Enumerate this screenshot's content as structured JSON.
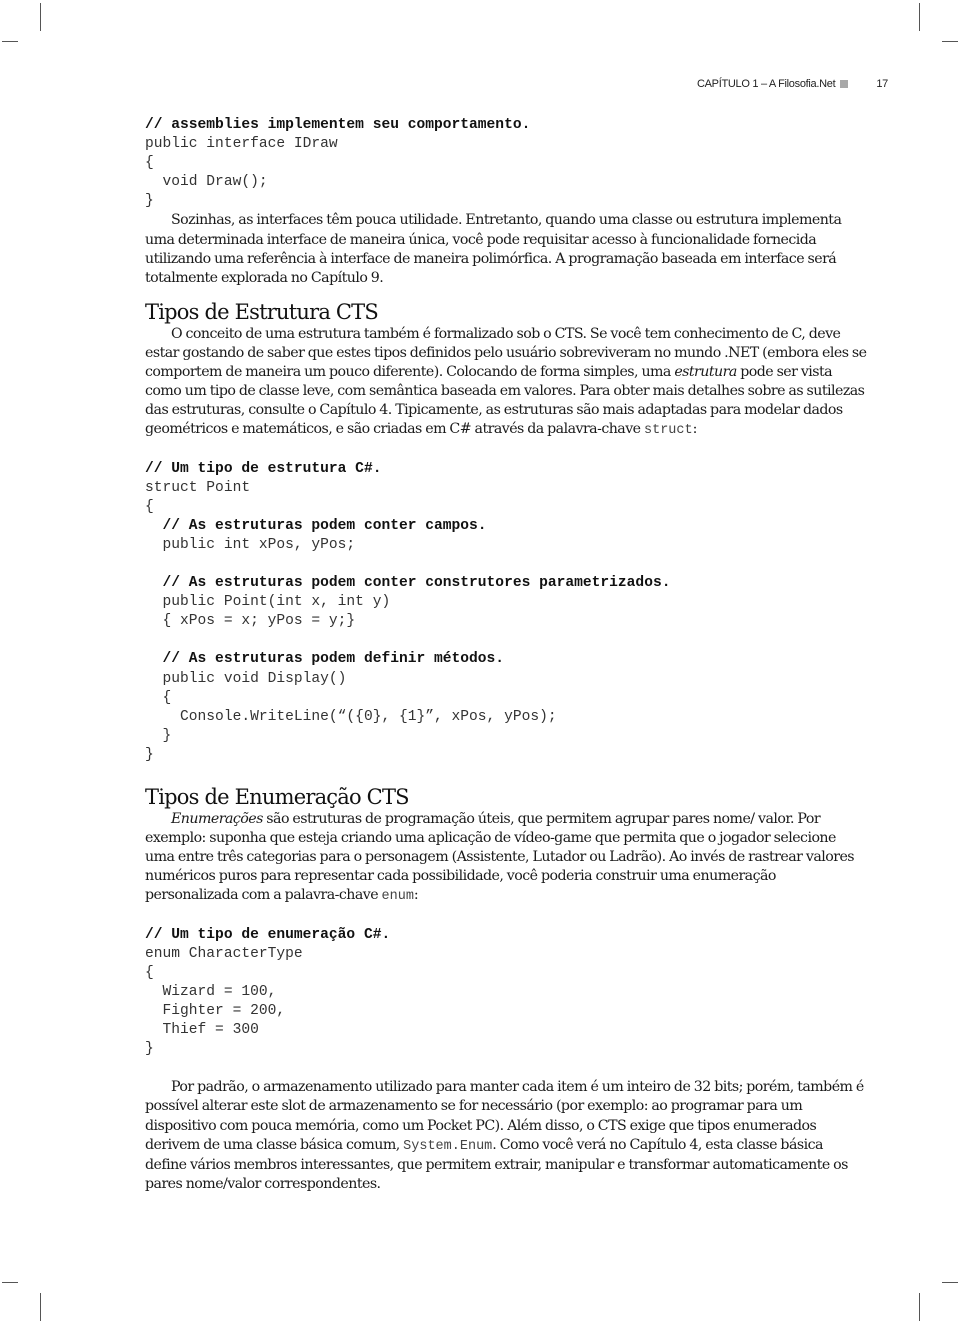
{
  "page_header": {
    "chapter": "CAPÍTULO 1 – A Filosofia.Net",
    "page_number": "17"
  },
  "code_block_1": {
    "lines": [
      {
        "text": "// assemblies implementem seu comportamento.",
        "type": "comment"
      },
      {
        "text": "public interface IDraw",
        "type": "code"
      },
      {
        "text": "{",
        "type": "code"
      },
      {
        "text": "  void Draw();",
        "type": "code"
      },
      {
        "text": "}",
        "type": "code"
      }
    ]
  },
  "para_1": {
    "text": "Sozinhas, as interfaces têm pouca utilidade. Entretanto, quando uma classe ou estrutura implementa uma determinada interface de maneira única, você pode requisitar acesso à funcionalidade fornecida utilizando uma referência à interface de maneira polimórfica. A programação baseada em interface será totalmente explorada no Capítulo 9."
  },
  "section_struct": {
    "heading": "Tipos de Estrutura CTS",
    "para_a": "O conceito de uma estrutura também é formalizado sob o CTS. Se você tem conhecimento de C, deve estar gostando de saber que estes tipos definidos pelo usuário sobreviveram no mundo .NET (embora eles se comportem de maneira um pouco diferente). Colocando de forma simples, uma ",
    "para_italic": "estrutura",
    "para_b": " pode ser vista como um tipo de classe leve, com semântica baseada em valores. Para obter mais detalhes sobre as sutilezas das estruturas, consulte o Capítulo 4. Tipicamente, as estruturas são mais adaptadas para modelar dados geométricos e matemáticos, e são criadas em C# através da palavra-chave ",
    "para_code": "struct",
    "para_end": ":"
  },
  "code_block_2": {
    "lines": [
      {
        "text": "// Um tipo de estrutura C#.",
        "type": "comment"
      },
      {
        "text": "struct Point",
        "type": "code"
      },
      {
        "text": "{",
        "type": "code"
      },
      {
        "text": "  // As estruturas podem conter campos.",
        "type": "comment"
      },
      {
        "text": "  public int xPos, yPos;",
        "type": "code"
      },
      {
        "text": "",
        "type": "code"
      },
      {
        "text": "  // As estruturas podem conter construtores parametrizados.",
        "type": "comment"
      },
      {
        "text": "  public Point(int x, int y)",
        "type": "code"
      },
      {
        "text": "  { xPos = x; yPos = y;}",
        "type": "code"
      },
      {
        "text": "",
        "type": "code"
      },
      {
        "text": "  // As estruturas podem definir métodos.",
        "type": "comment"
      },
      {
        "text": "  public void Display()",
        "type": "code"
      },
      {
        "text": "  {",
        "type": "code"
      },
      {
        "text": "    Console.WriteLine(“({0}, {1}”, xPos, yPos);",
        "type": "code"
      },
      {
        "text": "  }",
        "type": "code"
      },
      {
        "text": "}",
        "type": "code"
      }
    ]
  },
  "section_enum": {
    "heading": "Tipos de Enumeração CTS",
    "para_italic": "Enumerações",
    "para_a": " são estruturas de programação úteis, que permitem agrupar pares nome/ valor. Por exemplo: suponha que esteja criando uma aplicação de vídeo-game que permita que o jogador selecione uma entre três categorias para o personagem (Assistente, Lutador ou Ladrão). Ao invés de rastrear valores numéricos puros para representar cada possibilidade, você poderia construir uma enumeração personalizada com a palavra-chave ",
    "para_code": "enum",
    "para_end": ":"
  },
  "code_block_3": {
    "lines": [
      {
        "text": "// Um tipo de enumeração C#.",
        "type": "comment"
      },
      {
        "text": "enum CharacterType",
        "type": "code"
      },
      {
        "text": "{",
        "type": "code"
      },
      {
        "text": "  Wizard = 100,",
        "type": "code"
      },
      {
        "text": "  Fighter = 200,",
        "type": "code"
      },
      {
        "text": "  Thief = 300",
        "type": "code"
      },
      {
        "text": "}",
        "type": "code"
      }
    ]
  },
  "para_final": {
    "text_a": "Por padrão, o armazenamento utilizado para manter cada item é um inteiro de 32 bits; porém, também é possível alterar este slot de armazenamento se for necessário (por exemplo: ao programar para um dispositivo com pouca memória, como um Pocket PC). Além disso, o CTS exige que tipos enumerados derivem de uma classe básica comum, ",
    "code": "System.Enum",
    "text_b": ". Como você verá no Capítulo 4, esta classe básica define vários membros interessantes, que permitem extrair, manipular e transformar automaticamente os pares nome/valor correspondentes."
  }
}
